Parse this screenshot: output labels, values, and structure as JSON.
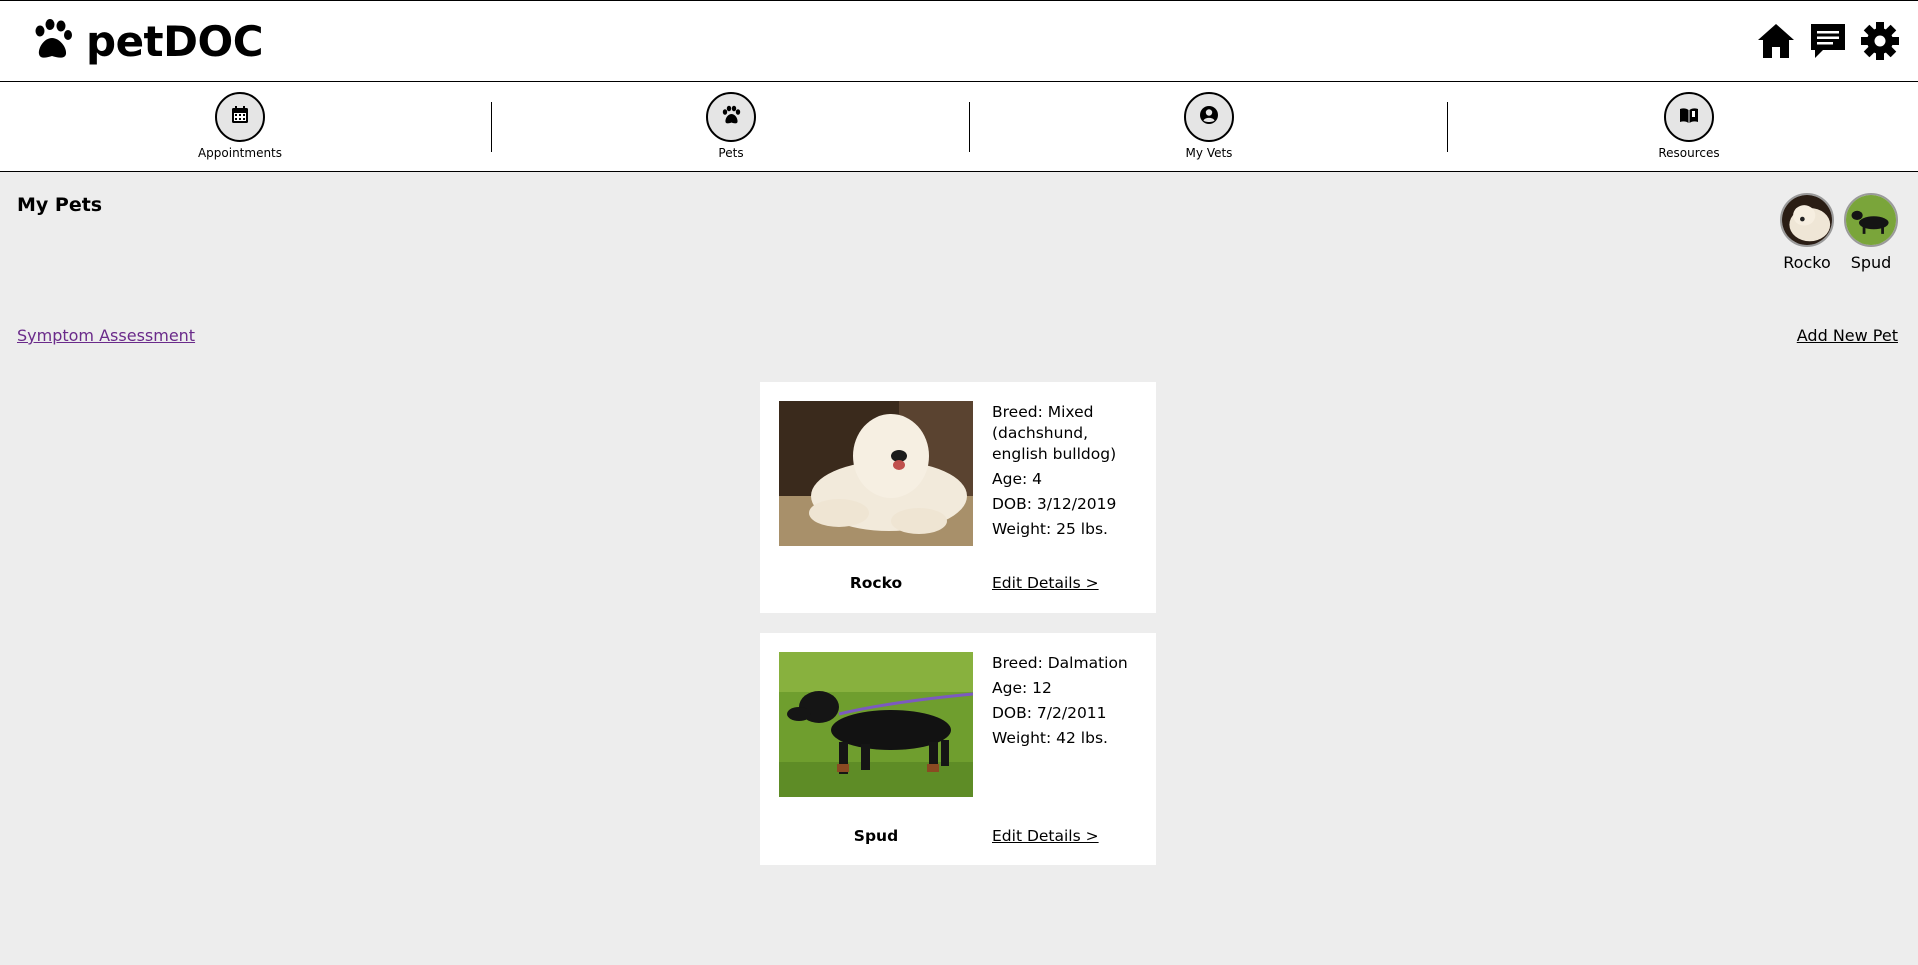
{
  "app": {
    "name": "petDOC"
  },
  "header": {
    "icons": [
      "home-icon",
      "chat-icon",
      "gear-icon"
    ]
  },
  "nav": {
    "items": [
      {
        "label": "Appointments",
        "icon": "calendar-icon"
      },
      {
        "label": "Pets",
        "icon": "paw-icon"
      },
      {
        "label": "My Vets",
        "icon": "user-circle-icon"
      },
      {
        "label": "Resources",
        "icon": "book-icon"
      }
    ]
  },
  "page": {
    "title": "My Pets",
    "symptom_link": "Symptom Assessment",
    "add_pet_link": "Add New Pet"
  },
  "avatars": [
    {
      "name": "Rocko"
    },
    {
      "name": "Spud"
    }
  ],
  "pets": [
    {
      "name": "Rocko",
      "breed": "Breed: Mixed (dachshund, english bulldog)",
      "age": "Age: 4",
      "dob": "DOB: 3/12/2019",
      "weight": "Weight: 25 lbs.",
      "edit_label": "Edit Details >"
    },
    {
      "name": "Spud",
      "breed": "Breed: Dalmation",
      "age": "Age: 12",
      "dob": "DOB: 7/2/2011",
      "weight": "Weight: 42 lbs.",
      "edit_label": "Edit Details >"
    }
  ],
  "colors": {
    "background": "#ededed",
    "link_visited": "#6a2a8a",
    "nav_circle": "#e5e5e5"
  }
}
